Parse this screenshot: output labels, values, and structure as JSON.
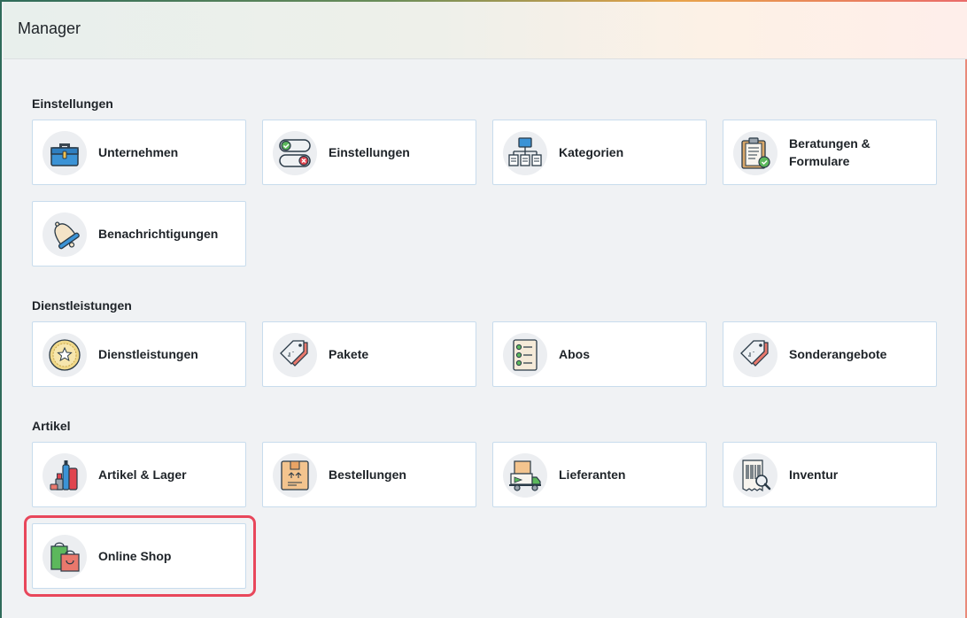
{
  "header": {
    "title": "Manager"
  },
  "sections": [
    {
      "title": "Einstellungen",
      "items": [
        {
          "label": "Unternehmen",
          "icon": "briefcase-icon"
        },
        {
          "label": "Einstellungen",
          "icon": "toggle-switches-icon"
        },
        {
          "label": "Kategorien",
          "icon": "hierarchy-icon"
        },
        {
          "label": "Beratungen & Formulare",
          "icon": "clipboard-check-icon"
        },
        {
          "label": "Benachrichtigungen",
          "icon": "bell-icon"
        }
      ]
    },
    {
      "title": "Dienstleistungen",
      "items": [
        {
          "label": "Dienstleistungen",
          "icon": "coin-star-icon"
        },
        {
          "label": "Pakete",
          "icon": "price-tags-icon"
        },
        {
          "label": "Abos",
          "icon": "checklist-icon"
        },
        {
          "label": "Sonderangebote",
          "icon": "price-tags-icon"
        }
      ]
    },
    {
      "title": "Artikel",
      "items": [
        {
          "label": "Artikel & Lager",
          "icon": "cosmetics-icon"
        },
        {
          "label": "Bestellungen",
          "icon": "package-box-icon"
        },
        {
          "label": "Lieferanten",
          "icon": "delivery-truck-icon"
        },
        {
          "label": "Inventur",
          "icon": "barcode-search-icon"
        },
        {
          "label": "Online Shop",
          "icon": "shopping-bags-icon"
        }
      ]
    }
  ],
  "colors": {
    "highlight": "#e8475b",
    "card_border": "#c8dced"
  }
}
